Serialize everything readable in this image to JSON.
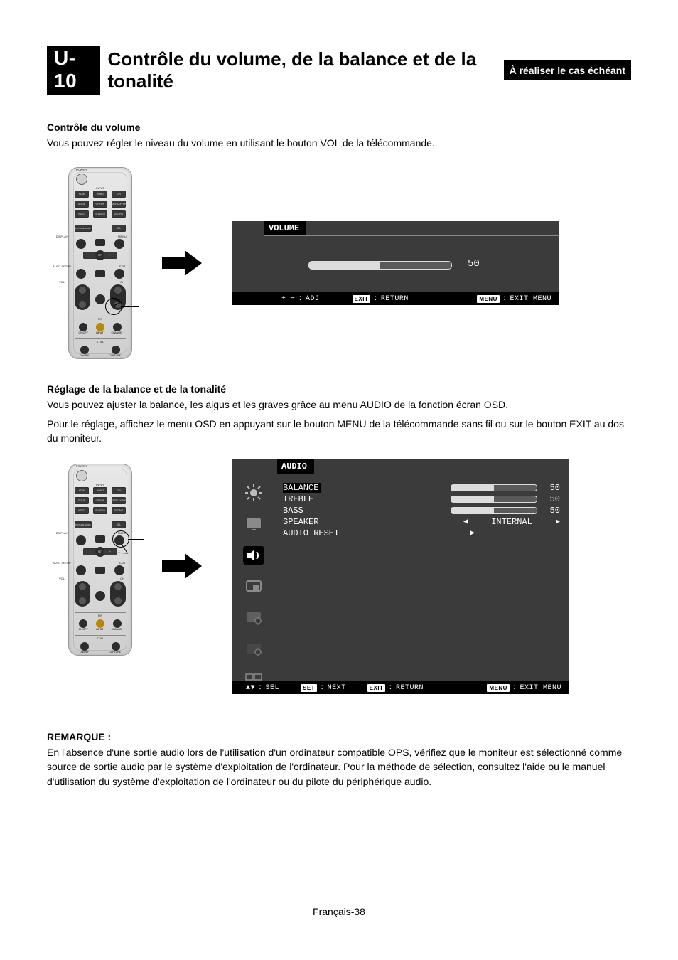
{
  "header": {
    "badge": "U-10",
    "title": "Contrôle du volume, de la balance et de la tonalité",
    "side": "À réaliser le cas échéant"
  },
  "section1": {
    "heading": "Contrôle du volume",
    "body": "Vous pouvez régler le niveau du volume en utilisant le bouton VOL de la télécommande."
  },
  "osd_volume": {
    "title": "VOLUME",
    "value": "50",
    "footer": {
      "adj_sym": "+ −",
      "adj_colon": ":",
      "adj": "ADJ",
      "exit_key": "EXIT",
      "exit_colon": ":",
      "return": "RETURN",
      "menu_key": "MENU",
      "menu_colon": ":",
      "exitmenu": "EXIT MENU"
    }
  },
  "section2": {
    "heading": "Réglage de la balance et de la tonalité",
    "body1": "Vous pouvez ajuster la balance, les aigus et les graves grâce au menu AUDIO de la fonction écran OSD.",
    "body2": "Pour le réglage, affichez le menu OSD en appuyant sur le bouton MENU de la télécommande sans fil ou sur le bouton EXIT au dos du moniteur."
  },
  "osd_audio": {
    "title": "AUDIO",
    "rows": {
      "balance": {
        "label": "BALANCE",
        "value": "50"
      },
      "treble": {
        "label": "TREBLE",
        "value": "50"
      },
      "bass": {
        "label": "BASS",
        "value": "50"
      },
      "speaker": {
        "label": "SPEAKER",
        "value": "INTERNAL"
      },
      "reset": {
        "label": "AUDIO RESET"
      }
    },
    "footer": {
      "sel_sym": "▲▼",
      "sel_colon": ":",
      "sel": "SEL",
      "set_key": "SET",
      "set_colon": ":",
      "next": "NEXT",
      "exit_key": "EXIT",
      "exit_colon": ":",
      "return": "RETURN",
      "menu_key": "MENU",
      "menu_colon": ":",
      "exitmenu": "EXIT MENU"
    }
  },
  "remark": {
    "heading": "REMARQUE :",
    "body": "En l'absence d'une sortie audio lors de l'utilisation d'un ordinateur compatible OPS, vérifiez que le moniteur est sélectionné comme source de sortie audio par le système d'exploitation de l'ordinateur. Pour la méthode de sélection, consultez l'aide ou le manuel d'utilisation du système d'exploitation de l'ordinateur ou du pilote du périphérique audio."
  },
  "remote_labels": {
    "power": "POWER",
    "input": "INPUT",
    "r1": [
      "HDMI",
      "HDMI2",
      "DVI"
    ],
    "r2": [
      "D-SUB",
      "OPTION",
      "DISPLAYPORT"
    ],
    "r3": [
      "VIDEO",
      "S-VIDEO",
      "DVD/HD"
    ],
    "pm": "PICTURE MODE",
    "sel": "SEL",
    "display": "DISPLAY",
    "menu": "MENU",
    "set": "SET",
    "auto": "AUTO SETUP",
    "exit": "EXIT",
    "vol": "VOL",
    "still": "STILL",
    "pip": "PIP",
    "ch": "CH",
    "onoff": "ON/OFF",
    "capture": "CAPTURE",
    "change": "CHANGE"
  },
  "footer": {
    "pagenum": "Français-38"
  }
}
